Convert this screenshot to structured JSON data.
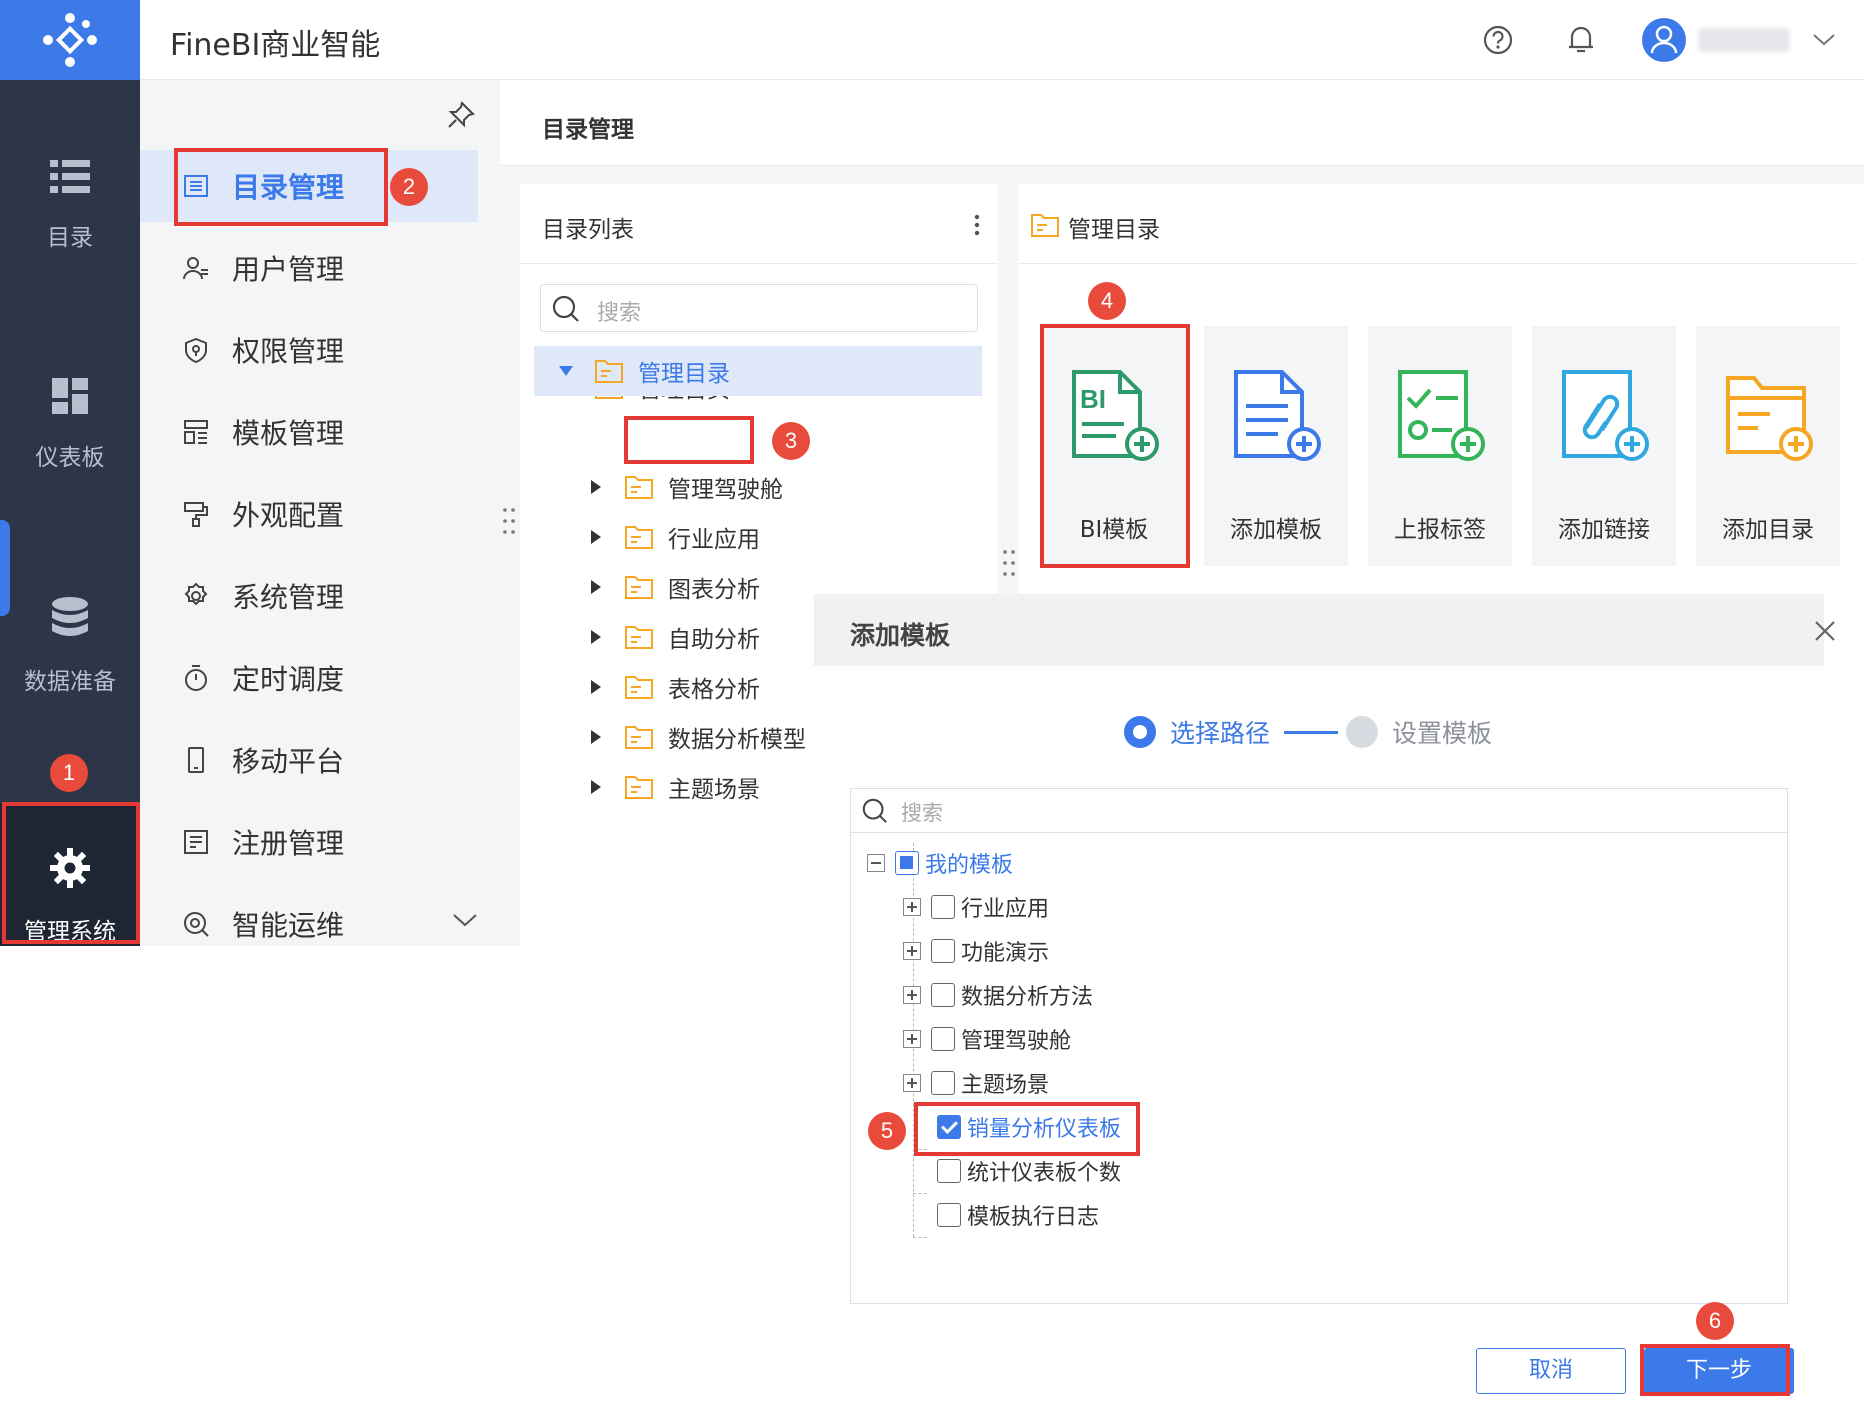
{
  "app": {
    "title": "FineBI商业智能"
  },
  "rail": {
    "items": [
      {
        "label": "目录",
        "icon": "list-icon"
      },
      {
        "label": "仪表板",
        "icon": "dashboard-icon"
      },
      {
        "label": "数据准备",
        "icon": "database-icon"
      },
      {
        "label": "管理系统",
        "icon": "gear-icon",
        "active": true
      }
    ]
  },
  "submenu": {
    "items": [
      {
        "label": "目录管理",
        "icon": "catalog-icon",
        "active": true
      },
      {
        "label": "用户管理",
        "icon": "user-icon"
      },
      {
        "label": "权限管理",
        "icon": "shield-icon"
      },
      {
        "label": "模板管理",
        "icon": "template-icon"
      },
      {
        "label": "外观配置",
        "icon": "paint-roller-icon"
      },
      {
        "label": "系统管理",
        "icon": "gear-icon"
      },
      {
        "label": "定时调度",
        "icon": "timer-icon"
      },
      {
        "label": "移动平台",
        "icon": "mobile-icon"
      },
      {
        "label": "注册管理",
        "icon": "register-icon"
      },
      {
        "label": "智能运维",
        "icon": "ops-icon"
      }
    ]
  },
  "main": {
    "title": "目录管理"
  },
  "dir_panel": {
    "title": "目录列表",
    "search_placeholder": "搜索",
    "tree": [
      {
        "label": "管理首页",
        "level": 0,
        "expanded": false
      },
      {
        "label": "管理目录",
        "level": 0,
        "expanded": true,
        "selected": true
      },
      {
        "label": "管理驾驶舱",
        "level": 1
      },
      {
        "label": "行业应用",
        "level": 1
      },
      {
        "label": "图表分析",
        "level": 1
      },
      {
        "label": "自助分析",
        "level": 1
      },
      {
        "label": "表格分析",
        "level": 1
      },
      {
        "label": "数据分析模型",
        "level": 1
      },
      {
        "label": "主题场景",
        "level": 1
      }
    ]
  },
  "right_panel": {
    "title": "管理目录",
    "cards": [
      {
        "label": "BI模板",
        "icon": "bi-template-add-icon",
        "color": "#2e9a6b"
      },
      {
        "label": "添加模板",
        "icon": "template-add-icon",
        "color": "#3b7ae8"
      },
      {
        "label": "上报标签",
        "icon": "report-tag-add-icon",
        "color": "#35b559"
      },
      {
        "label": "添加链接",
        "icon": "link-add-icon",
        "color": "#2fa7e0"
      },
      {
        "label": "添加目录",
        "icon": "folder-add-icon",
        "color": "#f5a623"
      }
    ]
  },
  "dialog": {
    "title": "添加模板",
    "steps": [
      "选择路径",
      "设置模板"
    ],
    "search_placeholder": "搜索",
    "tree": {
      "root": "我的模板",
      "folders": [
        "行业应用",
        "功能演示",
        "数据分析方法",
        "管理驾驶舱",
        "主题场景"
      ],
      "files": [
        {
          "label": "销量分析仪表板",
          "checked": true
        },
        {
          "label": "统计仪表板个数",
          "checked": false
        },
        {
          "label": "模板执行日志",
          "checked": false
        }
      ]
    },
    "cancel_label": "取消",
    "next_label": "下一步"
  },
  "annotations": [
    "1",
    "2",
    "3",
    "4",
    "5",
    "6"
  ],
  "colors": {
    "accent": "#3b7ae8",
    "rail": "#2c3648",
    "highlight": "#e53935",
    "folder": "#f5a623"
  }
}
